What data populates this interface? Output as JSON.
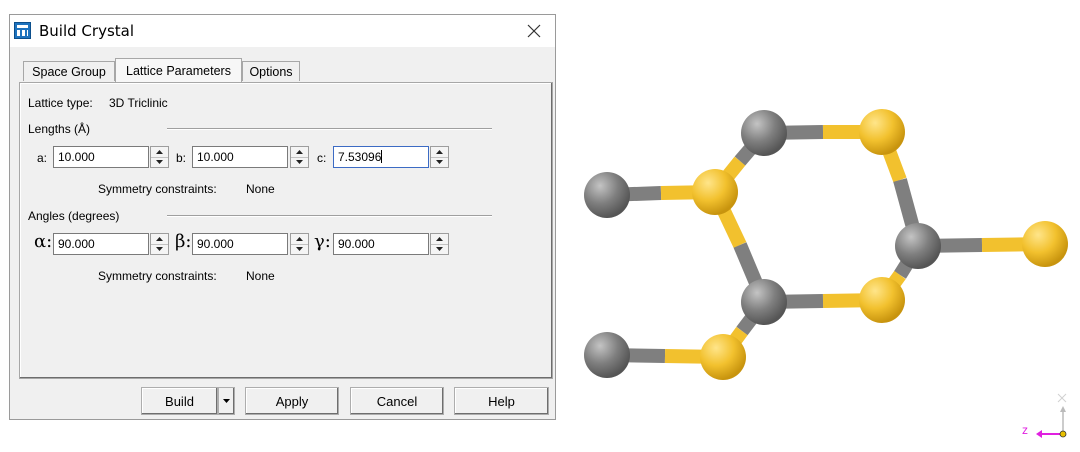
{
  "window": {
    "title": "Build Crystal"
  },
  "tabs": [
    {
      "label": "Space Group"
    },
    {
      "label": "Lattice Parameters",
      "active": true
    },
    {
      "label": "Options"
    }
  ],
  "lattice": {
    "type_label": "Lattice type:",
    "type_value": "3D Triclinic"
  },
  "lengths": {
    "heading": "Lengths (Å)",
    "a_label": "a:",
    "a_value": "10.000",
    "b_label": "b:",
    "b_value": "10.000",
    "c_label": "c:",
    "c_value": "7.53096",
    "symmetry_label": "Symmetry constraints:",
    "symmetry_value": "None"
  },
  "angles": {
    "heading": "Angles (degrees)",
    "alpha_label": "α:",
    "alpha_value": "90.000",
    "beta_label": "β:",
    "beta_value": "90.000",
    "gamma_label": "γ:",
    "gamma_value": "90.000",
    "symmetry_label": "Symmetry constraints:",
    "symmetry_value": "None"
  },
  "buttons": {
    "build": "Build",
    "apply": "Apply",
    "cancel": "Cancel",
    "help": "Help"
  },
  "axis": {
    "z_label": "z"
  },
  "colors": {
    "carbon_atom": "#7f7f7f",
    "sulfur_atom": "#f2c12e",
    "z_axis": "#e020e0"
  }
}
